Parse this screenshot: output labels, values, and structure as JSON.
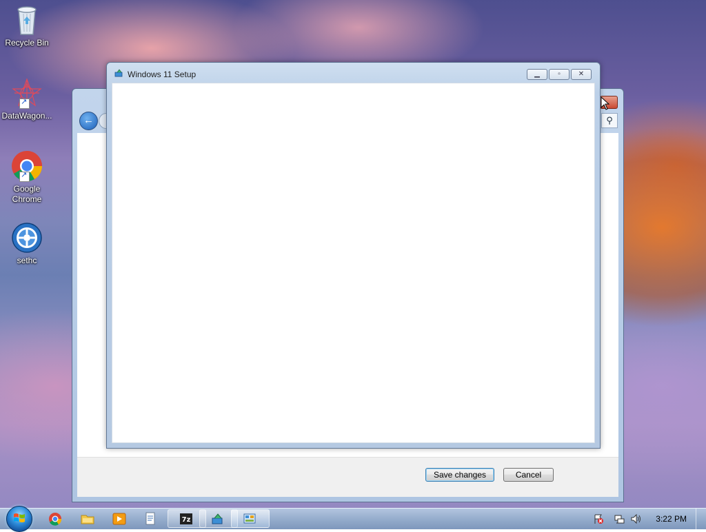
{
  "desktop": {
    "icons": [
      {
        "label": "Recycle Bin",
        "icon": "recycle-bin-icon"
      },
      {
        "label": "DataWagon...",
        "icon": "datawagon-icon"
      },
      {
        "label": "Google Chrome",
        "icon": "chrome-icon"
      },
      {
        "label": "sethc",
        "icon": "sethc-icon"
      }
    ]
  },
  "front_window": {
    "title": "Windows 11 Setup",
    "icon": "setup-icon",
    "minimize": "minimize-icon",
    "maximize": "maximize-icon",
    "close": "close-icon"
  },
  "back_window": {
    "save_label": "Save changes",
    "cancel_label": "Cancel"
  },
  "taskbar": {
    "clock": "3:22 PM",
    "pinned": [
      "chrome-icon",
      "explorer-icon",
      "media-player-icon",
      "notepad-icon"
    ],
    "running": [
      "7zip-icon",
      "setup-icon",
      "control-panel-icon"
    ],
    "tray": [
      "action-center-flag-icon",
      "network-icon",
      "volume-icon"
    ]
  },
  "colors": {
    "accent": "#3c7fb1",
    "taskbar": "#96afcd",
    "close_red": "#c94a33"
  }
}
